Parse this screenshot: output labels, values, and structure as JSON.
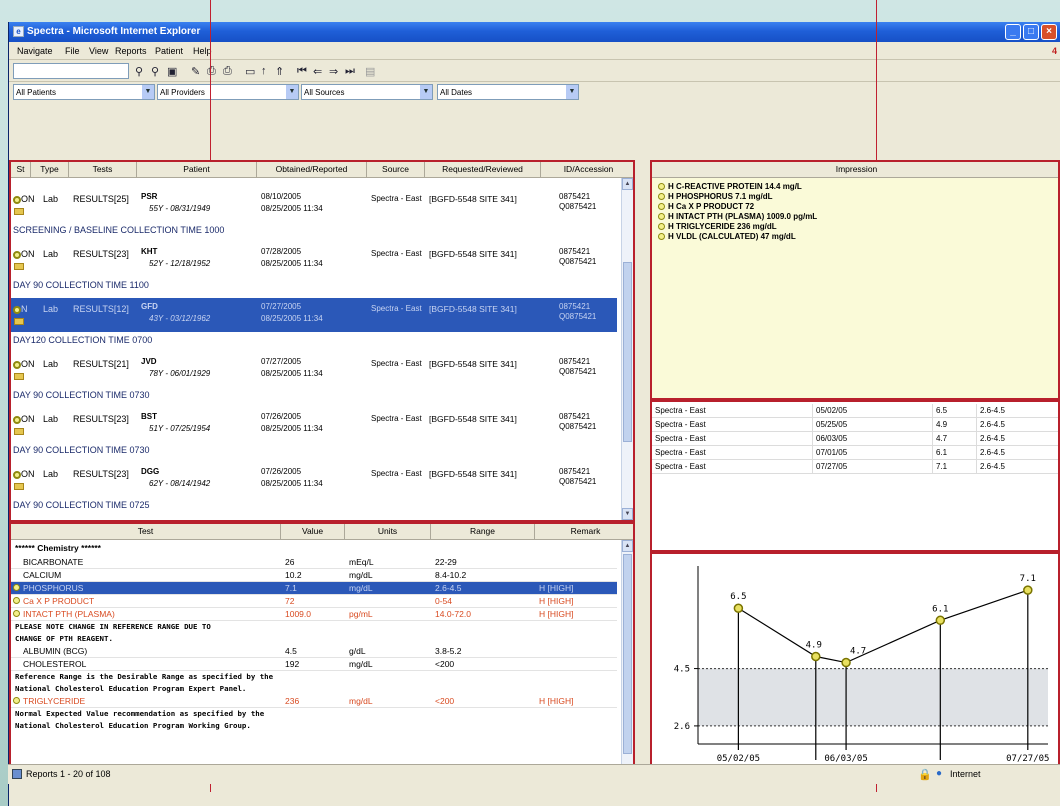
{
  "window": {
    "title": "Spectra - Microsoft Internet Explorer",
    "badge": "4"
  },
  "menu": [
    "Navigate",
    "File",
    "View",
    "Reports",
    "Patient",
    "Help"
  ],
  "filters": [
    "All Patients",
    "All Providers",
    "All Sources",
    "All Dates"
  ],
  "reports": {
    "columns": [
      "St",
      "Type",
      "Tests",
      "Patient",
      "Obtained/Reported",
      "Source",
      "Requested/Reviewed",
      "ID/Accession"
    ],
    "rows": [
      {
        "status": "ON",
        "type": "Lab",
        "tests": "RESULTS[25]",
        "patient": "PSR",
        "patient_info": "55Y - 08/31/1949",
        "obtained": "08/10/2005",
        "reported": "08/25/2005 11:34",
        "source": "Spectra - East",
        "requested": "[BGFD-5548 SITE 341]",
        "id1": "0875421",
        "id2": "Q0875421",
        "collection": "SCREENING / BASELINE   COLLECTION TIME 1000"
      },
      {
        "status": "ON",
        "type": "Lab",
        "tests": "RESULTS[23]",
        "patient": "KHT",
        "patient_info": "52Y - 12/18/1952",
        "obtained": "07/28/2005",
        "reported": "08/25/2005 11:34",
        "source": "Spectra - East",
        "requested": "[BGFD-5548 SITE 341]",
        "id1": "0875421",
        "id2": "Q0875421",
        "collection": "DAY 90   COLLECTION TIME 1100"
      },
      {
        "status": "N",
        "type": "Lab",
        "tests": "RESULTS[12]",
        "patient": "GFD",
        "patient_info": "43Y - 03/12/1962",
        "obtained": "07/27/2005",
        "reported": "08/25/2005 11:34",
        "source": "Spectra - East",
        "requested": "[BGFD-5548 SITE 341]",
        "id1": "0875421",
        "id2": "Q0875421",
        "collection": "DAY120  COLLECTION TIME 0700",
        "selected": true
      },
      {
        "status": "ON",
        "type": "Lab",
        "tests": "RESULTS[21]",
        "patient": "JVD",
        "patient_info": "78Y - 06/01/1929",
        "obtained": "07/27/2005",
        "reported": "08/25/2005 11:34",
        "source": "Spectra - East",
        "requested": "[BGFD-5548 SITE 341]",
        "id1": "0875421",
        "id2": "Q0875421",
        "collection": "DAY 90   COLLECTION TIME 0730"
      },
      {
        "status": "ON",
        "type": "Lab",
        "tests": "RESULTS[23]",
        "patient": "BST",
        "patient_info": "51Y - 07/25/1954",
        "obtained": "07/26/2005",
        "reported": "08/25/2005 11:34",
        "source": "Spectra - East",
        "requested": "[BGFD-5548 SITE 341]",
        "id1": "0875421",
        "id2": "Q0875421",
        "collection": "DAY 90   COLLECTION TIME 0730"
      },
      {
        "status": "ON",
        "type": "Lab",
        "tests": "RESULTS[23]",
        "patient": "DGG",
        "patient_info": "62Y - 08/14/1942",
        "obtained": "07/26/2005",
        "reported": "08/25/2005 11:34",
        "source": "Spectra - East",
        "requested": "[BGFD-5548 SITE 341]",
        "id1": "0875421",
        "id2": "Q0875421",
        "collection": "DAY 90   COLLECTION TIME 0725"
      }
    ]
  },
  "tests": {
    "columns": [
      "Test",
      "Value",
      "Units",
      "Range",
      "Remark"
    ],
    "section": "****** Chemistry ******",
    "rows": [
      {
        "test": "BICARBONATE",
        "value": "26",
        "units": "mEq/L",
        "range": "22-29",
        "remark": ""
      },
      {
        "test": "CALCIUM",
        "value": "10.2",
        "units": "mg/dL",
        "range": "8.4-10.2",
        "remark": ""
      },
      {
        "test": "PHOSPHORUS",
        "value": "7.1",
        "units": "mg/dL",
        "range": "2.6-4.5",
        "remark": "H [HIGH]",
        "style": "sel"
      },
      {
        "test": "Ca X P PRODUCT",
        "value": "72",
        "units": "",
        "range": "0-54",
        "remark": "H [HIGH]",
        "style": "red"
      },
      {
        "test": "INTACT PTH (PLASMA)",
        "value": "1009.0",
        "units": "pg/mL",
        "range": "14.0-72.0",
        "remark": "H [HIGH]",
        "style": "red"
      },
      {
        "test": "ALBUMIN (BCG)",
        "value": "4.5",
        "units": "g/dL",
        "range": "3.8-5.2",
        "remark": ""
      },
      {
        "test": "CHOLESTEROL",
        "value": "192",
        "units": "mg/dL",
        "range": "<200",
        "remark": ""
      },
      {
        "test": "TRIGLYCERIDE",
        "value": "236",
        "units": "mg/dL",
        "range": "<200",
        "remark": "H [HIGH]",
        "style": "red"
      }
    ],
    "notes": [
      "PLEASE NOTE CHANGE IN REFERENCE RANGE DUE TO",
      "CHANGE OF PTH REAGENT.",
      "Reference Range is the Desirable Range as specified by the",
      "National Cholesterol Education Program Expert Panel.",
      "Normal Expected Value recommendation as specified by the",
      "National Cholesterol Education Program Working Group."
    ]
  },
  "impression": {
    "header": "Impression",
    "items": [
      "H C-REACTIVE PROTEIN 14.4 mg/L",
      "H PHOSPHORUS 7.1 mg/dL",
      "H Ca X P PRODUCT 72",
      "H INTACT PTH (PLASMA) 1009.0 pg/mL",
      "H TRIGLYCERIDE 236 mg/dL",
      "H VLDL (CALCULATED) 47 mg/dL"
    ]
  },
  "history": [
    {
      "source": "Spectra - East",
      "date": "05/02/05",
      "value": "6.5",
      "range": "2.6-4.5"
    },
    {
      "source": "Spectra - East",
      "date": "05/25/05",
      "value": "4.9",
      "range": "2.6-4.5"
    },
    {
      "source": "Spectra - East",
      "date": "06/03/05",
      "value": "4.7",
      "range": "2.6-4.5"
    },
    {
      "source": "Spectra - East",
      "date": "07/01/05",
      "value": "6.1",
      "range": "2.6-4.5"
    },
    {
      "source": "Spectra - East",
      "date": "07/27/05",
      "value": "7.1",
      "range": "2.6-4.5"
    }
  ],
  "chart_data": {
    "type": "line",
    "x": [
      "05/02/05",
      "05/25/05",
      "06/03/05",
      "07/01/05",
      "07/27/05"
    ],
    "values": [
      6.5,
      4.9,
      4.7,
      6.1,
      7.1
    ],
    "reference_band": [
      2.6,
      4.5
    ],
    "ytick_labels": [
      "4.5",
      "2.6"
    ],
    "point_labels": [
      "6.5",
      "4.9",
      "4.7",
      "6.1",
      "7.1"
    ],
    "line_color": "#000000",
    "point_color": "#e8e060"
  },
  "status": {
    "left": "Reports 1 - 20 of 108",
    "zone": "Internet"
  }
}
